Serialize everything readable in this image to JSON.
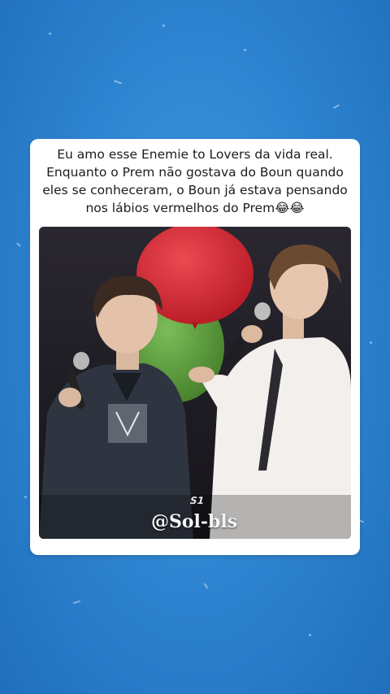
{
  "post": {
    "caption_lines": [
      "Eu amo esse Enemie to Lovers da vida real.",
      "Enquanto o Prem não gostava do Boun quando",
      "eles se conheceram, o Boun já estava pensando",
      "nos lábios vermelhos do Prem😂😂"
    ],
    "photo": {
      "watermark": "@Sol-bls",
      "watermark_logo": "S1"
    }
  },
  "colors": {
    "background": "#2f86d2",
    "card": "#ffffff",
    "balloon_red": "#d4242f",
    "balloon_green": "#5a9a3e"
  }
}
